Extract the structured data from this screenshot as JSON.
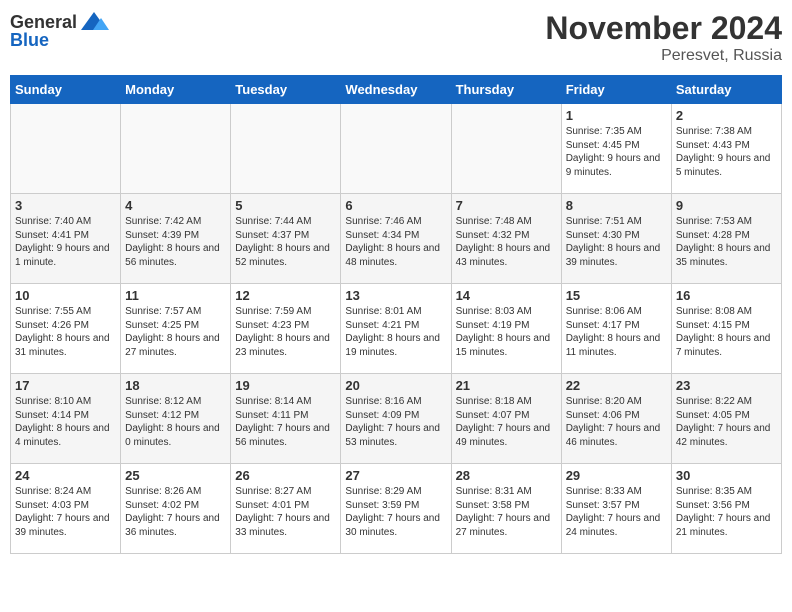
{
  "logo": {
    "general": "General",
    "blue": "Blue"
  },
  "title": "November 2024",
  "location": "Peresvet, Russia",
  "days_header": [
    "Sunday",
    "Monday",
    "Tuesday",
    "Wednesday",
    "Thursday",
    "Friday",
    "Saturday"
  ],
  "weeks": [
    {
      "days": [
        {
          "num": "",
          "empty": true
        },
        {
          "num": "",
          "empty": true
        },
        {
          "num": "",
          "empty": true
        },
        {
          "num": "",
          "empty": true
        },
        {
          "num": "",
          "empty": true
        },
        {
          "num": "1",
          "sunrise": "Sunrise: 7:35 AM",
          "sunset": "Sunset: 4:45 PM",
          "daylight": "Daylight: 9 hours and 9 minutes."
        },
        {
          "num": "2",
          "sunrise": "Sunrise: 7:38 AM",
          "sunset": "Sunset: 4:43 PM",
          "daylight": "Daylight: 9 hours and 5 minutes."
        }
      ]
    },
    {
      "days": [
        {
          "num": "3",
          "sunrise": "Sunrise: 7:40 AM",
          "sunset": "Sunset: 4:41 PM",
          "daylight": "Daylight: 9 hours and 1 minute."
        },
        {
          "num": "4",
          "sunrise": "Sunrise: 7:42 AM",
          "sunset": "Sunset: 4:39 PM",
          "daylight": "Daylight: 8 hours and 56 minutes."
        },
        {
          "num": "5",
          "sunrise": "Sunrise: 7:44 AM",
          "sunset": "Sunset: 4:37 PM",
          "daylight": "Daylight: 8 hours and 52 minutes."
        },
        {
          "num": "6",
          "sunrise": "Sunrise: 7:46 AM",
          "sunset": "Sunset: 4:34 PM",
          "daylight": "Daylight: 8 hours and 48 minutes."
        },
        {
          "num": "7",
          "sunrise": "Sunrise: 7:48 AM",
          "sunset": "Sunset: 4:32 PM",
          "daylight": "Daylight: 8 hours and 43 minutes."
        },
        {
          "num": "8",
          "sunrise": "Sunrise: 7:51 AM",
          "sunset": "Sunset: 4:30 PM",
          "daylight": "Daylight: 8 hours and 39 minutes."
        },
        {
          "num": "9",
          "sunrise": "Sunrise: 7:53 AM",
          "sunset": "Sunset: 4:28 PM",
          "daylight": "Daylight: 8 hours and 35 minutes."
        }
      ]
    },
    {
      "days": [
        {
          "num": "10",
          "sunrise": "Sunrise: 7:55 AM",
          "sunset": "Sunset: 4:26 PM",
          "daylight": "Daylight: 8 hours and 31 minutes."
        },
        {
          "num": "11",
          "sunrise": "Sunrise: 7:57 AM",
          "sunset": "Sunset: 4:25 PM",
          "daylight": "Daylight: 8 hours and 27 minutes."
        },
        {
          "num": "12",
          "sunrise": "Sunrise: 7:59 AM",
          "sunset": "Sunset: 4:23 PM",
          "daylight": "Daylight: 8 hours and 23 minutes."
        },
        {
          "num": "13",
          "sunrise": "Sunrise: 8:01 AM",
          "sunset": "Sunset: 4:21 PM",
          "daylight": "Daylight: 8 hours and 19 minutes."
        },
        {
          "num": "14",
          "sunrise": "Sunrise: 8:03 AM",
          "sunset": "Sunset: 4:19 PM",
          "daylight": "Daylight: 8 hours and 15 minutes."
        },
        {
          "num": "15",
          "sunrise": "Sunrise: 8:06 AM",
          "sunset": "Sunset: 4:17 PM",
          "daylight": "Daylight: 8 hours and 11 minutes."
        },
        {
          "num": "16",
          "sunrise": "Sunrise: 8:08 AM",
          "sunset": "Sunset: 4:15 PM",
          "daylight": "Daylight: 8 hours and 7 minutes."
        }
      ]
    },
    {
      "days": [
        {
          "num": "17",
          "sunrise": "Sunrise: 8:10 AM",
          "sunset": "Sunset: 4:14 PM",
          "daylight": "Daylight: 8 hours and 4 minutes."
        },
        {
          "num": "18",
          "sunrise": "Sunrise: 8:12 AM",
          "sunset": "Sunset: 4:12 PM",
          "daylight": "Daylight: 8 hours and 0 minutes."
        },
        {
          "num": "19",
          "sunrise": "Sunrise: 8:14 AM",
          "sunset": "Sunset: 4:11 PM",
          "daylight": "Daylight: 7 hours and 56 minutes."
        },
        {
          "num": "20",
          "sunrise": "Sunrise: 8:16 AM",
          "sunset": "Sunset: 4:09 PM",
          "daylight": "Daylight: 7 hours and 53 minutes."
        },
        {
          "num": "21",
          "sunrise": "Sunrise: 8:18 AM",
          "sunset": "Sunset: 4:07 PM",
          "daylight": "Daylight: 7 hours and 49 minutes."
        },
        {
          "num": "22",
          "sunrise": "Sunrise: 8:20 AM",
          "sunset": "Sunset: 4:06 PM",
          "daylight": "Daylight: 7 hours and 46 minutes."
        },
        {
          "num": "23",
          "sunrise": "Sunrise: 8:22 AM",
          "sunset": "Sunset: 4:05 PM",
          "daylight": "Daylight: 7 hours and 42 minutes."
        }
      ]
    },
    {
      "days": [
        {
          "num": "24",
          "sunrise": "Sunrise: 8:24 AM",
          "sunset": "Sunset: 4:03 PM",
          "daylight": "Daylight: 7 hours and 39 minutes."
        },
        {
          "num": "25",
          "sunrise": "Sunrise: 8:26 AM",
          "sunset": "Sunset: 4:02 PM",
          "daylight": "Daylight: 7 hours and 36 minutes."
        },
        {
          "num": "26",
          "sunrise": "Sunrise: 8:27 AM",
          "sunset": "Sunset: 4:01 PM",
          "daylight": "Daylight: 7 hours and 33 minutes."
        },
        {
          "num": "27",
          "sunrise": "Sunrise: 8:29 AM",
          "sunset": "Sunset: 3:59 PM",
          "daylight": "Daylight: 7 hours and 30 minutes."
        },
        {
          "num": "28",
          "sunrise": "Sunrise: 8:31 AM",
          "sunset": "Sunset: 3:58 PM",
          "daylight": "Daylight: 7 hours and 27 minutes."
        },
        {
          "num": "29",
          "sunrise": "Sunrise: 8:33 AM",
          "sunset": "Sunset: 3:57 PM",
          "daylight": "Daylight: 7 hours and 24 minutes."
        },
        {
          "num": "30",
          "sunrise": "Sunrise: 8:35 AM",
          "sunset": "Sunset: 3:56 PM",
          "daylight": "Daylight: 7 hours and 21 minutes."
        }
      ]
    }
  ]
}
